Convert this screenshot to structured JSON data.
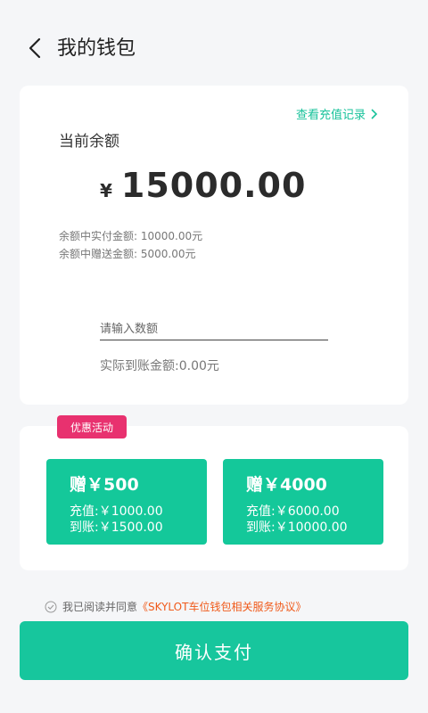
{
  "header": {
    "title": "我的钱包",
    "back_icon": "chevron-left-icon"
  },
  "balance": {
    "history_link": "查看充值记录",
    "label": "当前余额",
    "currency": "¥",
    "amount": "15000.00",
    "paid_line": "余额中实付金额: 10000.00元",
    "bonus_line": "余额中赠送金额: 5000.00元",
    "input_placeholder": "请输入数额",
    "actual_label": "实际到账金额:0.00元"
  },
  "promo": {
    "badge": "优惠活动",
    "options": [
      {
        "gift": "赠￥500",
        "pay": "充值:￥1000.00",
        "receive": "到账:￥1500.00"
      },
      {
        "gift": "赠￥4000",
        "pay": "充值:￥6000.00",
        "receive": "到账:￥10000.00"
      }
    ]
  },
  "agreement": {
    "prefix": "我已阅读并同意",
    "link": "《SKYLOT车位钱包相关服务协议》"
  },
  "confirm_button": "确认支付",
  "colors": {
    "accent": "#17c69d",
    "badge": "#e8316f",
    "link_orange": "#f05a1a",
    "background": "#f5f6f8"
  }
}
